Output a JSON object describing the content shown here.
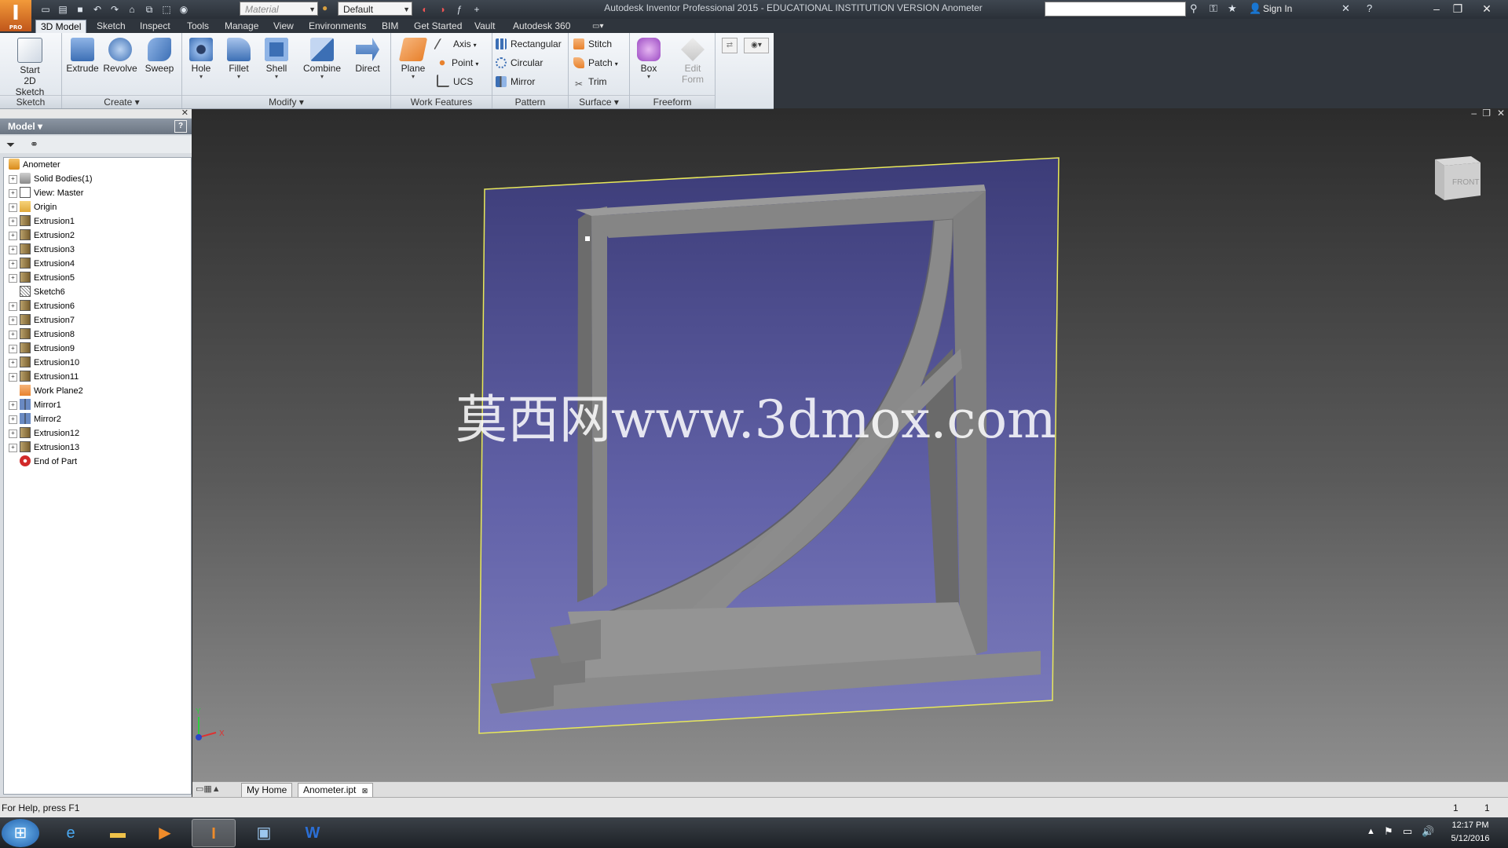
{
  "titlebar": {
    "app_badge": "I",
    "app_badge_sub": "PRO",
    "material": "Material",
    "appearance": "Default",
    "title": "Autodesk Inventor Professional 2015 - EDUCATIONAL INSTITUTION VERSION    Anometer",
    "sign_in": "Sign In"
  },
  "ribbon_tabs": [
    "3D Model",
    "Sketch",
    "Inspect",
    "Tools",
    "Manage",
    "View",
    "Environments",
    "BIM",
    "Get Started",
    "Vault",
    "Autodesk 360"
  ],
  "ribbon": {
    "sketch_panel": {
      "label": "Sketch",
      "start_sketch": "Start\n2D Sketch"
    },
    "create_panel": {
      "label": "Create",
      "extrude": "Extrude",
      "revolve": "Revolve",
      "sweep": "Sweep"
    },
    "modify_panel": {
      "label": "Modify",
      "hole": "Hole",
      "fillet": "Fillet",
      "shell": "Shell",
      "combine": "Combine",
      "direct": "Direct"
    },
    "work_features_panel": {
      "label": "Work Features",
      "plane": "Plane",
      "axis": "Axis",
      "point": "Point",
      "ucs": "UCS"
    },
    "pattern_panel": {
      "label": "Pattern",
      "rectangular": "Rectangular",
      "circular": "Circular",
      "mirror": "Mirror"
    },
    "surface_panel": {
      "label": "Surface",
      "stitch": "Stitch",
      "patch": "Patch",
      "trim": "Trim"
    },
    "freeform_panel": {
      "label": "Freeform",
      "box": "Box",
      "edit_form": "Edit\nForm"
    }
  },
  "browser": {
    "title": "Model",
    "tree": [
      {
        "label": "Anometer",
        "icon": "part-icon",
        "expandable": false,
        "indent": 0
      },
      {
        "label": "Solid Bodies(1)",
        "icon": "solid-bodies-icon",
        "expandable": true,
        "indent": 1
      },
      {
        "label": "View: Master",
        "icon": "view-icon",
        "expandable": true,
        "indent": 1
      },
      {
        "label": "Origin",
        "icon": "folder-icon",
        "expandable": true,
        "indent": 1
      },
      {
        "label": "Extrusion1",
        "icon": "extrusion-icon",
        "expandable": true,
        "indent": 1
      },
      {
        "label": "Extrusion2",
        "icon": "extrusion-icon",
        "expandable": true,
        "indent": 1
      },
      {
        "label": "Extrusion3",
        "icon": "extrusion-icon",
        "expandable": true,
        "indent": 1
      },
      {
        "label": "Extrusion4",
        "icon": "extrusion-icon",
        "expandable": true,
        "indent": 1
      },
      {
        "label": "Extrusion5",
        "icon": "extrusion-icon",
        "expandable": true,
        "indent": 1
      },
      {
        "label": "Sketch6",
        "icon": "sketch-icon",
        "expandable": false,
        "indent": 1
      },
      {
        "label": "Extrusion6",
        "icon": "extrusion-icon",
        "expandable": true,
        "indent": 1
      },
      {
        "label": "Extrusion7",
        "icon": "extrusion-icon",
        "expandable": true,
        "indent": 1
      },
      {
        "label": "Extrusion8",
        "icon": "extrusion-icon",
        "expandable": true,
        "indent": 1
      },
      {
        "label": "Extrusion9",
        "icon": "extrusion-icon",
        "expandable": true,
        "indent": 1
      },
      {
        "label": "Extrusion10",
        "icon": "extrusion-icon",
        "expandable": true,
        "indent": 1
      },
      {
        "label": "Extrusion11",
        "icon": "extrusion-icon",
        "expandable": true,
        "indent": 1
      },
      {
        "label": "Work Plane2",
        "icon": "work-plane-icon",
        "expandable": false,
        "indent": 1
      },
      {
        "label": "Mirror1",
        "icon": "mirror-icon",
        "expandable": true,
        "indent": 1
      },
      {
        "label": "Mirror2",
        "icon": "mirror-icon",
        "expandable": true,
        "indent": 1
      },
      {
        "label": "Extrusion12",
        "icon": "extrusion-icon",
        "expandable": true,
        "indent": 1
      },
      {
        "label": "Extrusion13",
        "icon": "extrusion-icon",
        "expandable": true,
        "indent": 1
      },
      {
        "label": "End of Part",
        "icon": "end-of-part-icon",
        "expandable": false,
        "indent": 1
      }
    ]
  },
  "viewport": {
    "viewcube_face": "FRONT",
    "watermark": "莫西网www.3dmox.com",
    "triad_x": "X",
    "triad_y": "Y"
  },
  "doc_tabs": [
    "My Home",
    "Anometer.ipt"
  ],
  "status": {
    "help": "For Help, press F1",
    "count1": "1",
    "count2": "1"
  },
  "taskbar": {
    "time": "12:17 PM",
    "date": "5/12/2016"
  },
  "colors": {
    "accent_orange": "#e8822e",
    "plane_purple": "#6a6ab0",
    "highlight_yellow": "#e8e85a",
    "part_gray": "#8a8a8a"
  }
}
